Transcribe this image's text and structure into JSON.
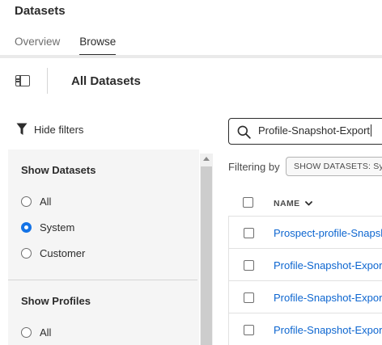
{
  "app": {
    "title": "Datasets"
  },
  "tabs": [
    {
      "label": "Overview",
      "active": false
    },
    {
      "label": "Browse",
      "active": true
    }
  ],
  "toolbar": {
    "page_title": "All Datasets",
    "panel_toggle_icon": "sidebar-panel-icon"
  },
  "filters": {
    "hide_label": "Hide filters",
    "show_datasets": {
      "heading": "Show Datasets",
      "options": [
        {
          "label": "All",
          "checked": false
        },
        {
          "label": "System",
          "checked": true
        },
        {
          "label": "Customer",
          "checked": false
        }
      ]
    },
    "show_profiles": {
      "heading": "Show Profiles",
      "options": [
        {
          "label": "All",
          "checked": false
        }
      ]
    }
  },
  "search": {
    "value": "Profile-Snapshot-Export"
  },
  "filtering": {
    "label": "Filtering by",
    "tag": "SHOW DATASETS: System"
  },
  "table": {
    "columns": [
      {
        "label": "NAME",
        "sorted": "desc"
      }
    ],
    "rows": [
      {
        "name": "Prospect-profile-Snapshot-Export"
      },
      {
        "name": "Profile-Snapshot-Export"
      },
      {
        "name": "Profile-Snapshot-Export"
      },
      {
        "name": "Profile-Snapshot-Export"
      }
    ]
  },
  "colors": {
    "accent": "#1473e6",
    "link": "#0d66d0",
    "panel_bg": "#f5f5f5"
  }
}
